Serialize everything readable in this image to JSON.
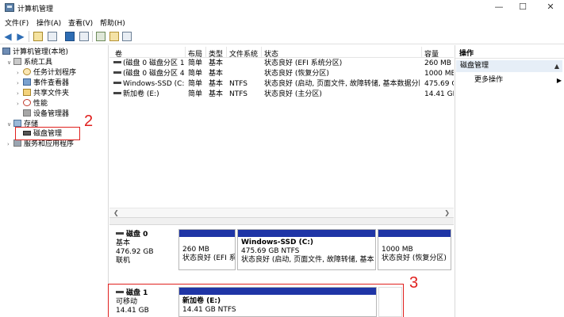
{
  "window": {
    "title": "计算机管理",
    "icon": "computer-management-icon"
  },
  "menu": [
    "文件(F)",
    "操作(A)",
    "查看(V)",
    "帮助(H)"
  ],
  "tree": {
    "root": "计算机管理(本地)",
    "system_tools": "系统工具",
    "task_scheduler": "任务计划程序",
    "event_viewer": "事件查看器",
    "shared_folders": "共享文件夹",
    "performance": "性能",
    "device_manager": "设备管理器",
    "storage": "存储",
    "disk_management": "磁盘管理",
    "services_apps": "服务和应用程序"
  },
  "annotations": {
    "two": "2",
    "three": "3"
  },
  "volume_table": {
    "columns": [
      "卷",
      "布局",
      "类型",
      "文件系统",
      "状态",
      "容量"
    ],
    "rows": [
      {
        "vol": "(磁盘 0 磁盘分区 1)",
        "layout": "简单",
        "type": "基本",
        "fs": "",
        "status": "状态良好 (EFI 系统分区)",
        "capacity": "260 MB"
      },
      {
        "vol": "(磁盘 0 磁盘分区 4)",
        "layout": "简单",
        "type": "基本",
        "fs": "",
        "status": "状态良好 (恢复分区)",
        "capacity": "1000 ME"
      },
      {
        "vol": "Windows-SSD (C:)",
        "layout": "简单",
        "type": "基本",
        "fs": "NTFS",
        "status": "状态良好 (启动, 页面文件, 故障转储, 基本数据分区)",
        "capacity": "475.69 G"
      },
      {
        "vol": "新加卷 (E:)",
        "layout": "简单",
        "type": "基本",
        "fs": "NTFS",
        "status": "状态良好 (主分区)",
        "capacity": "14.41 GE"
      }
    ]
  },
  "disks": [
    {
      "name": "磁盘 0",
      "kind": "基本",
      "size": "476.92 GB",
      "state": "联机",
      "partitions": [
        {
          "title": "",
          "line1": "260 MB",
          "line2": "状态良好 (EFI 系"
        },
        {
          "title": "Windows-SSD  (C:)",
          "line1": "475.69 GB NTFS",
          "line2": "状态良好 (启动, 页面文件, 故障转储, 基本"
        },
        {
          "title": "",
          "line1": "1000 MB",
          "line2": "状态良好 (恢复分区)"
        }
      ]
    },
    {
      "name": "磁盘 1",
      "kind": "可移动",
      "size": "14.41 GB",
      "partitions": [
        {
          "title": "新加卷  (E:)",
          "line1": "14.41 GB NTFS"
        }
      ]
    }
  ],
  "actions": {
    "header": "操作",
    "section": "磁盘管理",
    "more": "更多操作"
  },
  "colors": {
    "partition_bar": "#1f35a6",
    "annotation_red": "#e0201e",
    "section_bg": "#e6eef7"
  }
}
